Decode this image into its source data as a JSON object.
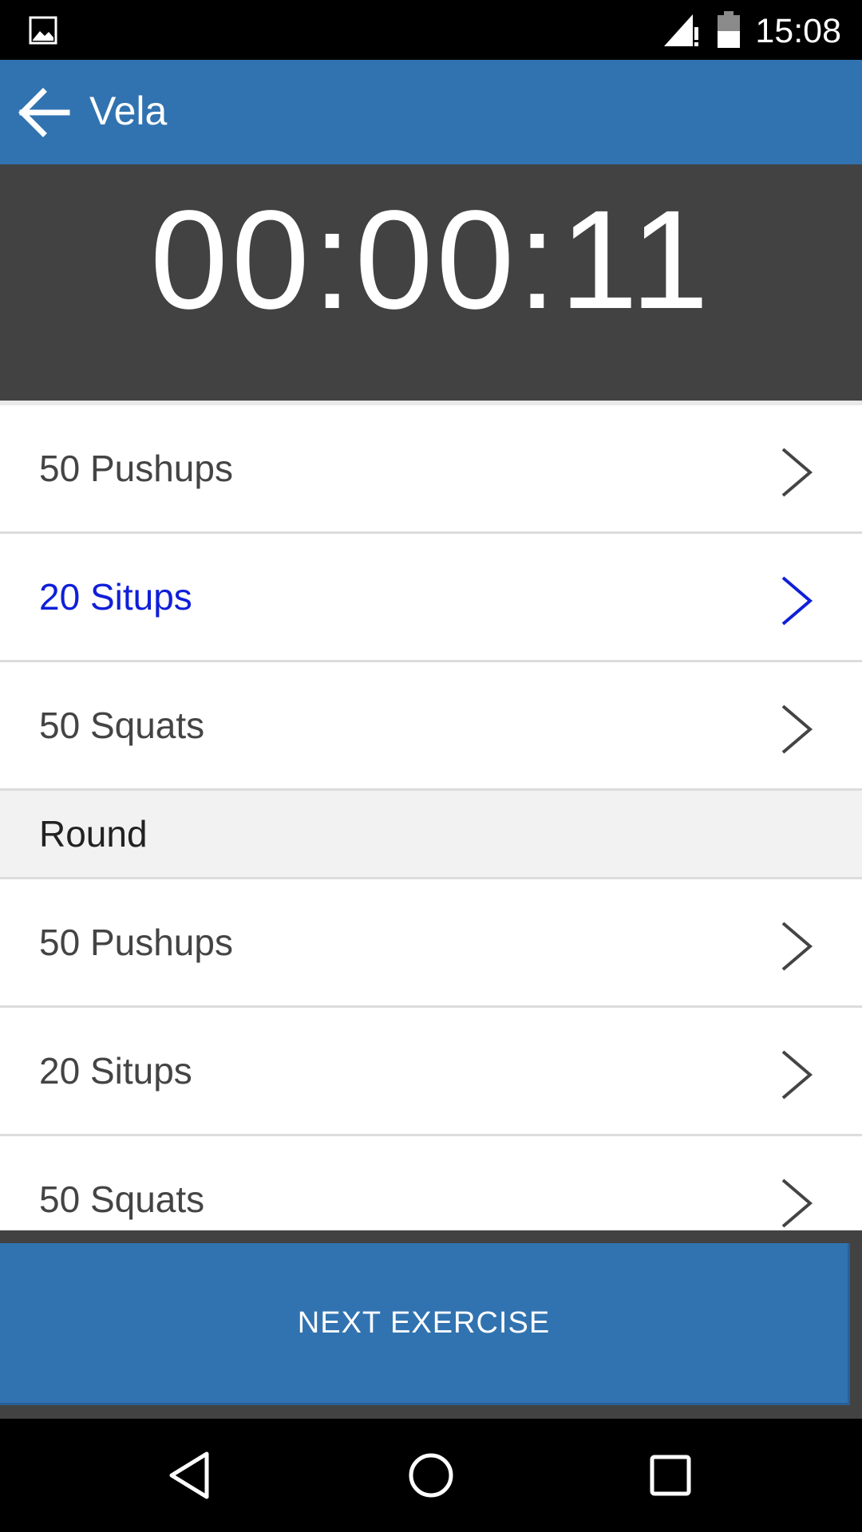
{
  "status_bar": {
    "time": "15:08",
    "icons": [
      "gallery-icon",
      "signal-icon",
      "battery-icon"
    ]
  },
  "app_bar": {
    "title": "Vela",
    "back_icon": "arrow-left-icon",
    "color": "#3173b0"
  },
  "timer": {
    "value": "00:00:11",
    "background": "#424242"
  },
  "exercises": [
    {
      "label": "50 Pushups",
      "active": false
    },
    {
      "label": "20 Situps",
      "active": true
    },
    {
      "label": "50 Squats",
      "active": false
    }
  ],
  "section": {
    "label": "Round"
  },
  "round_exercises": [
    {
      "label": "50 Pushups"
    },
    {
      "label": "20 Situps"
    },
    {
      "label": "50 Squats"
    }
  ],
  "next_button": {
    "label": "NEXT EXERCISE"
  },
  "nav_bar": {
    "icons": [
      "back-triangle-icon",
      "home-circle-icon",
      "recents-square-icon"
    ]
  },
  "colors": {
    "primary": "#3173b0",
    "active_text": "#0f1fd8",
    "text": "#444444"
  }
}
